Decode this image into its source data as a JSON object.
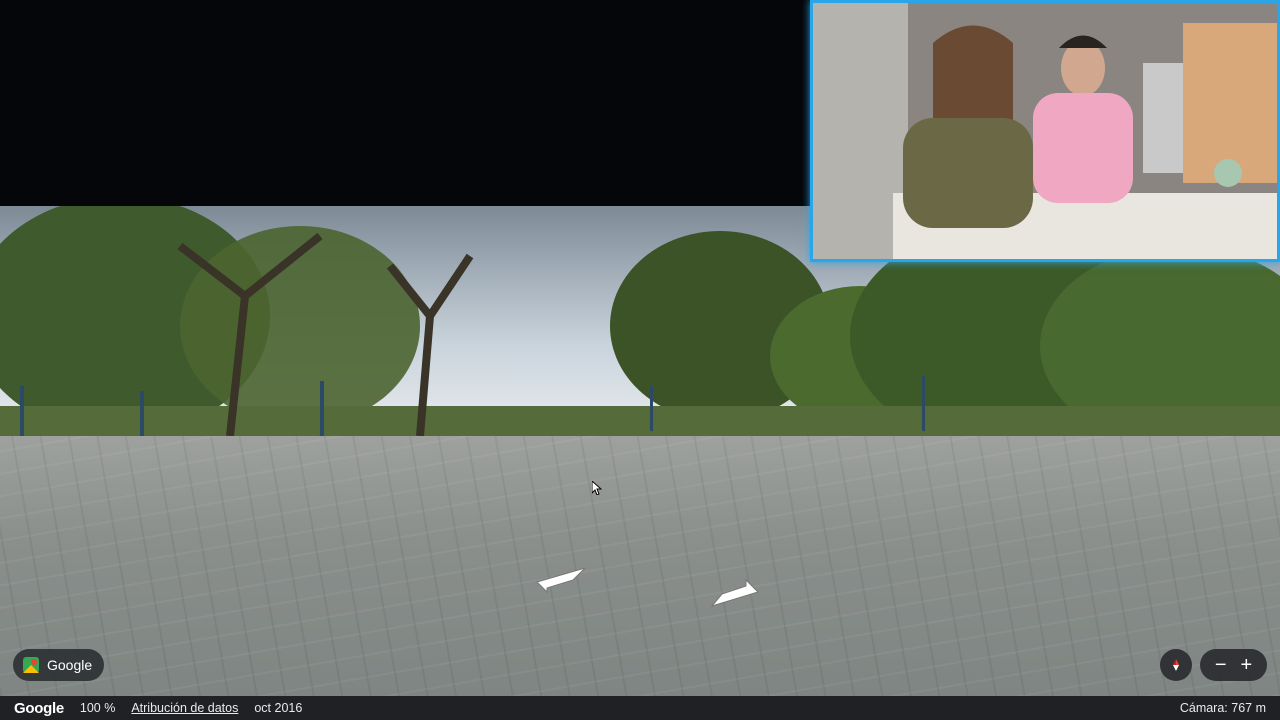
{
  "streetview": {
    "nav_arrows": [
      "left-arrow-icon",
      "right-arrow-icon"
    ]
  },
  "controls": {
    "google_button_label": "Google",
    "zoom_out": "−",
    "zoom_in": "+"
  },
  "footer": {
    "logo": "Google",
    "zoom_level": "100 %",
    "attribution_link": "Atribución de datos",
    "date": "oct 2016",
    "camera": "Cámara: 767 m"
  },
  "colors": {
    "webcam_border": "#2aa6e8",
    "footer_bg": "#202124"
  }
}
